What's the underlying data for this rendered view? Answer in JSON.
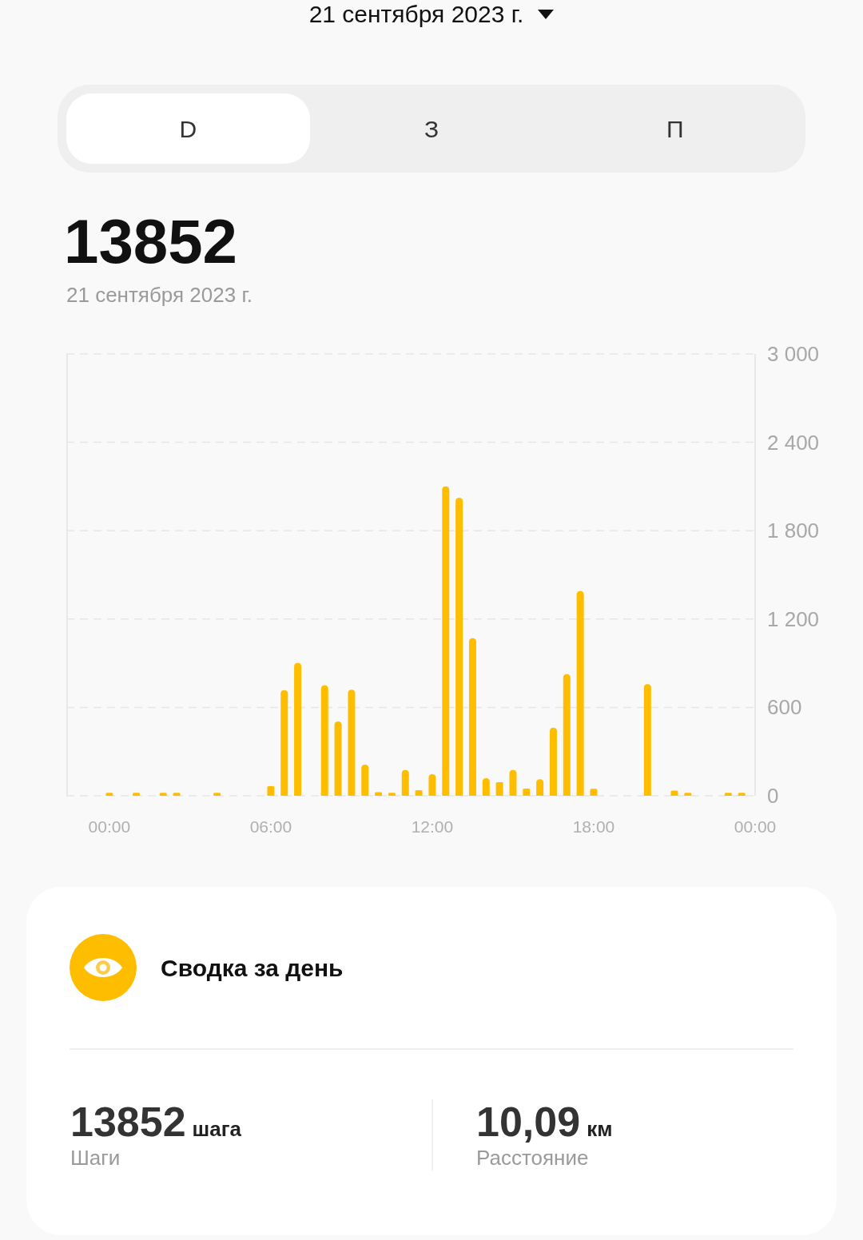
{
  "header": {
    "date": "21 сентября 2023 г."
  },
  "tabs": [
    {
      "label": "D",
      "selected": true
    },
    {
      "label": "З",
      "selected": false
    },
    {
      "label": "П",
      "selected": false
    }
  ],
  "total": {
    "value": "13852",
    "date": "21 сентября 2023 г."
  },
  "chart": {
    "chart_data": {
      "type": "bar",
      "x": [
        0,
        1,
        2,
        2.5,
        4,
        6,
        6.5,
        7,
        8,
        8.5,
        9,
        9.5,
        10,
        10.5,
        11,
        11.5,
        12,
        12.5,
        13,
        13.5,
        14,
        14.5,
        15,
        15.5,
        16,
        16.5,
        17,
        17.5,
        18,
        20,
        21,
        21.5,
        23,
        23.5
      ],
      "series": [
        {
          "color": "#ffbd00",
          "values": [
            20,
            20,
            20,
            20,
            20,
            65,
            718,
            902,
            750,
            504,
            720,
            212,
            25,
            20,
            175,
            38,
            146,
            2101,
            2024,
            1070,
            119,
            92,
            175,
            49,
            112,
            463,
            826,
            1390,
            47,
            758,
            35,
            20,
            20,
            20
          ]
        }
      ],
      "xlim": [
        -1.6,
        24
      ],
      "ylim": [
        0,
        3000
      ],
      "grid": true,
      "yticks": [
        0,
        600,
        {
          "value": 1200,
          "label": "1 200"
        },
        {
          "value": 1800,
          "label": "1 800"
        },
        {
          "value": 2400,
          "label": "2 400"
        },
        {
          "value": 3000,
          "label": "3 000"
        }
      ],
      "xticks": [
        {
          "value": 0,
          "label": "00:00"
        },
        {
          "value": 6,
          "label": "06:00"
        },
        {
          "value": 12,
          "label": "12:00"
        },
        {
          "value": 18,
          "label": "18:00"
        },
        {
          "value": 24,
          "label": "00:00"
        }
      ]
    }
  },
  "summary": {
    "title": "Сводка за день",
    "stats": [
      {
        "value": "13852",
        "unit": "шага",
        "label": "Шаги"
      },
      {
        "value": "10,09",
        "unit": "км",
        "label": "Расстояние"
      }
    ]
  }
}
